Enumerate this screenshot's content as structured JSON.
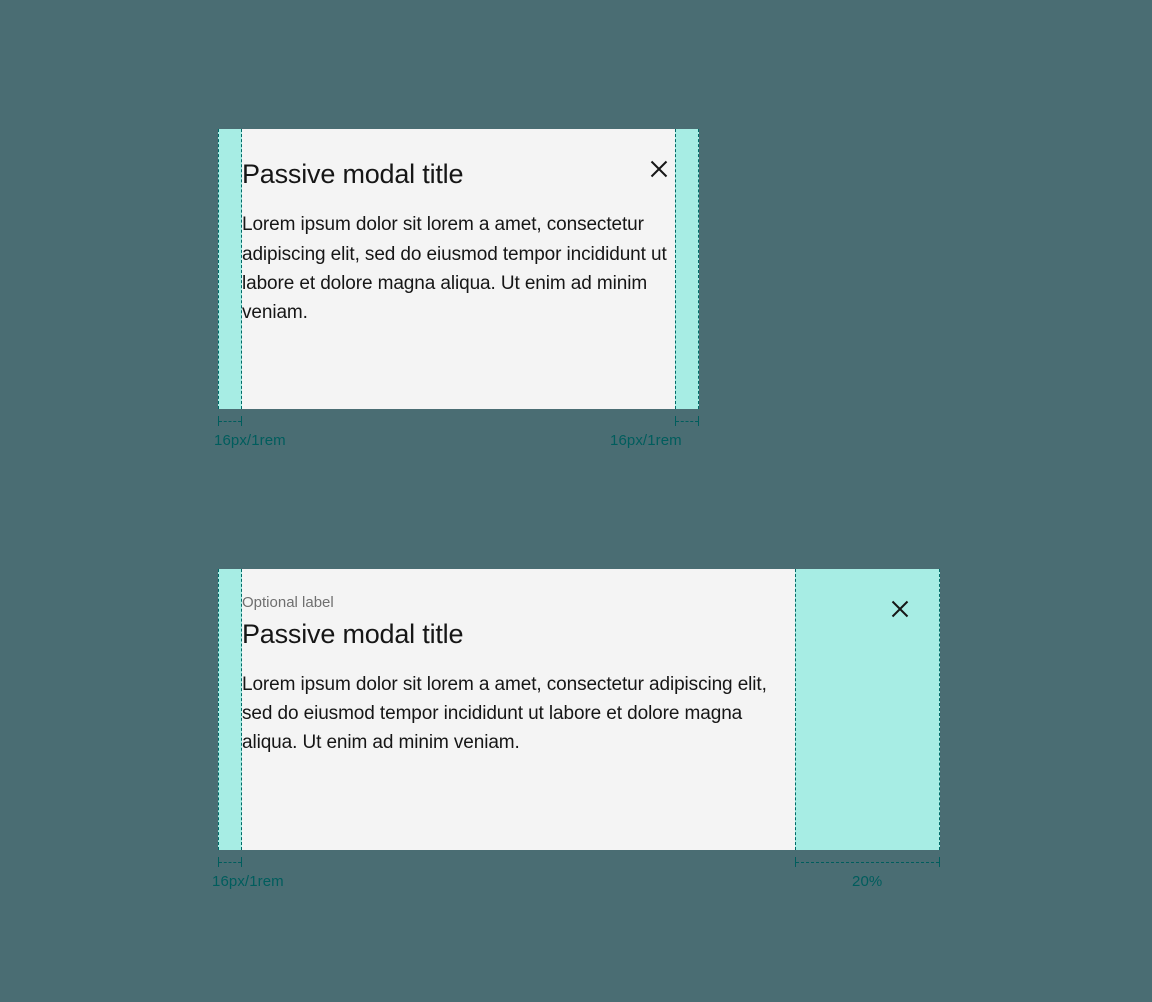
{
  "spec": {
    "accent": "#a7ede4",
    "guide": "#005d5d",
    "surface": "#f4f4f4"
  },
  "modal1": {
    "title": "Passive modal title",
    "body": "Lorem ipsum dolor sit lorem a amet, consectetur adipiscing elit, sed do eiusmod tempor incididunt ut labore et dolore magna aliqua. Ut enim ad minim veniam.",
    "left_measure": "16px/1rem",
    "right_measure": "16px/1rem"
  },
  "modal2": {
    "label": "Optional label",
    "title": "Passive modal title",
    "body": "Lorem ipsum dolor sit lorem a amet, consectetur adipiscing elit, sed do eiusmod tempor incididunt ut labore et dolore magna aliqua. Ut enim ad minim veniam.",
    "left_measure": "16px/1rem",
    "right_measure": "20%"
  }
}
